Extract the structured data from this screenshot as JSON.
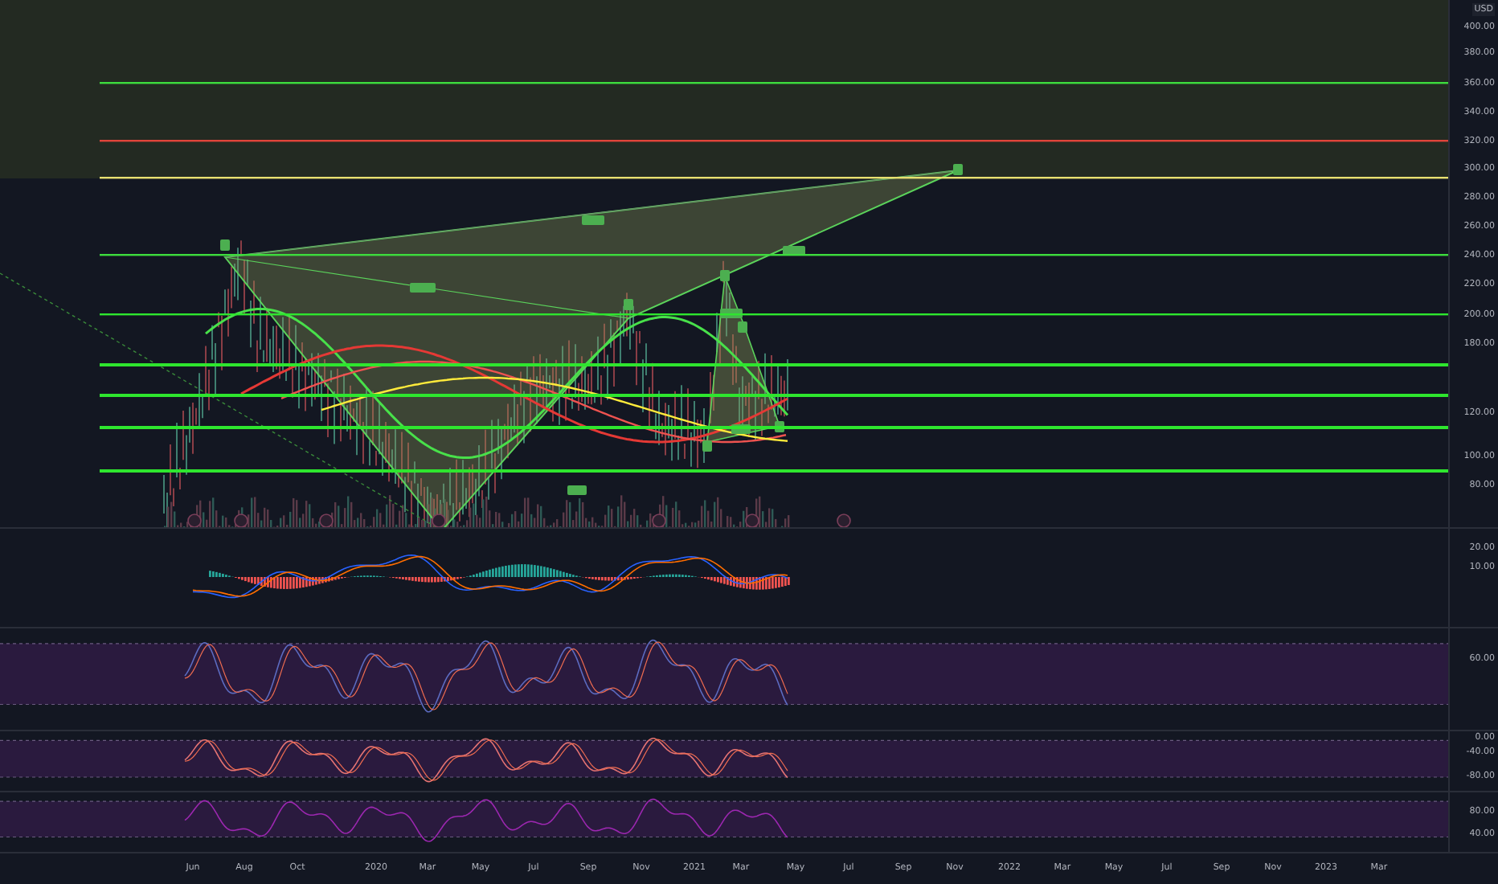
{
  "price_axis": {
    "currency": "USD",
    "ticks": [
      "400.00",
      "380.00",
      "360.00",
      "340.00",
      "320.00",
      "300.00",
      "280.00",
      "260.00",
      "240.00",
      "220.00",
      "200.00",
      "180.00",
      "120.00",
      "100.00",
      "80.00"
    ]
  },
  "fib_levels": [
    {
      "color": "#3ddc3d"
    },
    {
      "color": "#e0443a"
    },
    {
      "color": "#e8e070"
    },
    {
      "color": "#3ddc3d"
    },
    {
      "color": "#2ee62e"
    },
    {
      "color": "#2ee62e"
    },
    {
      "color": "#2ee62e"
    },
    {
      "color": "#2ee62e"
    },
    {
      "color": "#2ee62e"
    }
  ],
  "indicator_panes": [
    {
      "kind": "macd",
      "ticks": [
        "20.00",
        "10.00"
      ]
    },
    {
      "kind": "band",
      "ticks": [
        "60.00"
      ]
    },
    {
      "kind": "band",
      "ticks": [
        "0.00",
        "-40.00",
        "-80.00"
      ]
    },
    {
      "kind": "band",
      "ticks": [
        "80.00",
        "40.00"
      ]
    }
  ],
  "time_axis": [
    "Jun",
    "Aug",
    "Oct",
    "2020",
    "Mar",
    "May",
    "Jul",
    "Sep",
    "Nov",
    "2021",
    "Mar",
    "May",
    "Jul",
    "Sep",
    "Nov",
    "2022",
    "Mar",
    "May",
    "Jul",
    "Sep",
    "Nov",
    "2023",
    "Mar"
  ]
}
